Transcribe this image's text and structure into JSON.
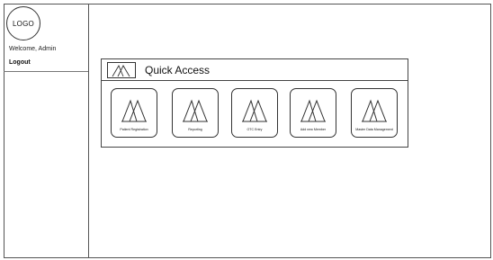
{
  "sidebar": {
    "logo_text": "LOGO",
    "welcome": "Welcome, Admin",
    "logout": "Logout"
  },
  "quick_access": {
    "title": "Quick Access",
    "tiles": [
      {
        "label": "Patient Registration",
        "icon": "image-placeholder-icon"
      },
      {
        "label": "Reporting",
        "icon": "image-placeholder-icon"
      },
      {
        "label": "OTC Entry",
        "icon": "image-placeholder-icon"
      },
      {
        "label": "Add new Member",
        "icon": "image-placeholder-icon"
      },
      {
        "label": "Master Data Management",
        "icon": "image-placeholder-icon"
      }
    ]
  }
}
